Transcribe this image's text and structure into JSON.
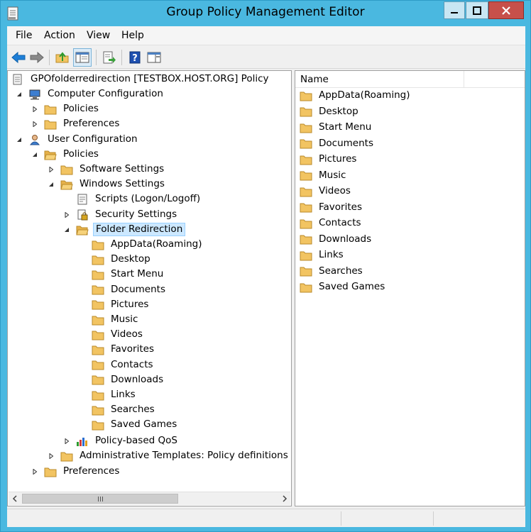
{
  "window": {
    "title": "Group Policy Management Editor"
  },
  "menu": [
    "File",
    "Action",
    "View",
    "Help"
  ],
  "toolbar": [
    "back-icon",
    "forward-icon",
    "up-folder-icon",
    "show-hide-tree-icon",
    "export-list-icon",
    "help-icon",
    "properties-pane-icon"
  ],
  "tree": {
    "root": "GPOfolderredirection [TESTBOX.HOST.ORG] Policy",
    "computer_config": "Computer Configuration",
    "cc_policies": "Policies",
    "cc_preferences": "Preferences",
    "user_config": "User Configuration",
    "uc_policies": "Policies",
    "software_settings": "Software Settings",
    "windows_settings": "Windows Settings",
    "scripts": "Scripts (Logon/Logoff)",
    "security_settings": "Security Settings",
    "folder_redirection": "Folder Redirection",
    "redirected_folders": [
      "AppData(Roaming)",
      "Desktop",
      "Start Menu",
      "Documents",
      "Pictures",
      "Music",
      "Videos",
      "Favorites",
      "Contacts",
      "Downloads",
      "Links",
      "Searches",
      "Saved Games"
    ],
    "policy_qos": "Policy-based QoS",
    "admin_templates": "Administrative Templates: Policy definitions (AD",
    "uc_preferences": "Preferences"
  },
  "list": {
    "column_name": "Name",
    "items": [
      "AppData(Roaming)",
      "Desktop",
      "Start Menu",
      "Documents",
      "Pictures",
      "Music",
      "Videos",
      "Favorites",
      "Contacts",
      "Downloads",
      "Links",
      "Searches",
      "Saved Games"
    ]
  },
  "colors": {
    "titlebar": "#4ab8e0",
    "close_button": "#c7504a",
    "selection": "#cce8ff",
    "folder": "#f2c462"
  }
}
